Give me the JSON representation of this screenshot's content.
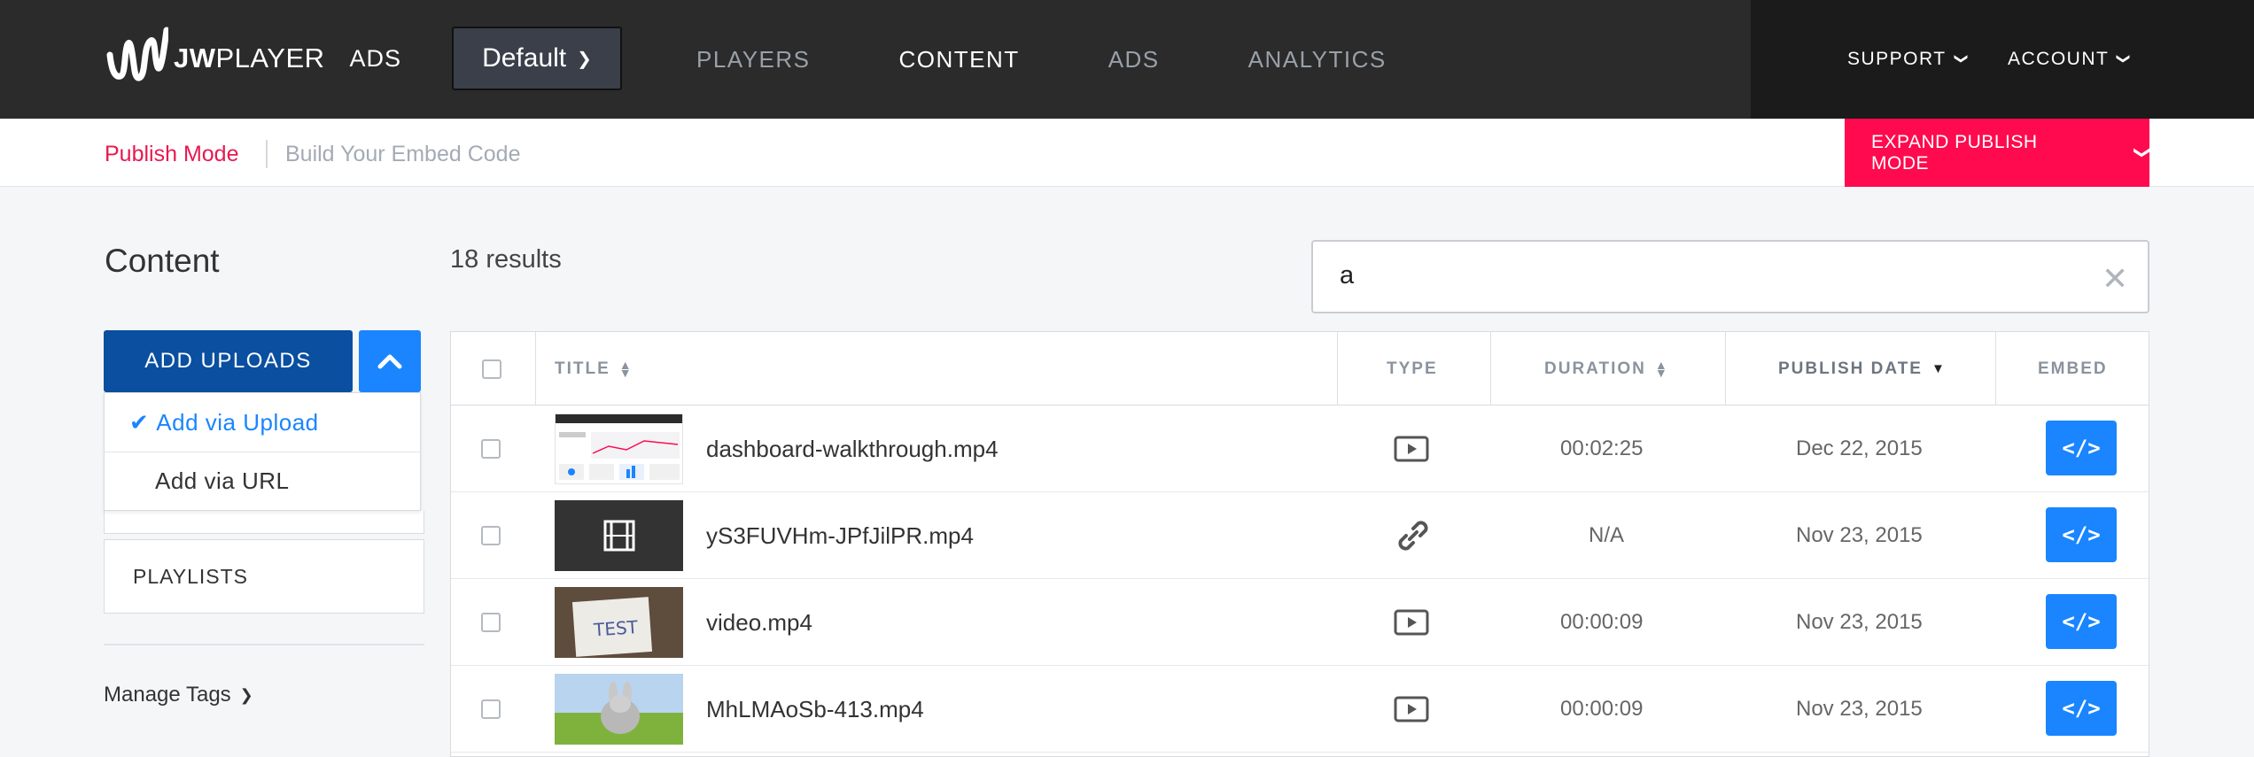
{
  "brand": {
    "logo_text_bold": "JW",
    "logo_text": "PLAYER",
    "product": "ADS"
  },
  "player_select": {
    "value": "Default"
  },
  "nav": {
    "items": [
      {
        "label": "PLAYERS",
        "active": false
      },
      {
        "label": "CONTENT",
        "active": true
      },
      {
        "label": "ADS",
        "active": false
      },
      {
        "label": "ANALYTICS",
        "active": false
      }
    ],
    "support": "SUPPORT",
    "account": "ACCOUNT"
  },
  "publish_bar": {
    "mode_label": "Publish Mode",
    "build_label": "Build Your Embed Code",
    "expand_label": "EXPAND PUBLISH MODE"
  },
  "sidebar": {
    "heading": "Content",
    "add_uploads": "ADD UPLOADS",
    "dropdown": {
      "options": [
        "Add via Upload",
        "Add via URL"
      ],
      "selected": "Add via Upload"
    },
    "playlists": "PLAYLISTS",
    "manage_tags": "Manage Tags"
  },
  "results": {
    "text": "18 results"
  },
  "search": {
    "value": "a"
  },
  "table": {
    "columns": {
      "title": "TITLE",
      "type": "TYPE",
      "duration": "DURATION",
      "publish_date": "PUBLISH DATE",
      "embed": "EMBED"
    },
    "rows": [
      {
        "title": "dashboard-walkthrough.mp4",
        "type": "video",
        "duration": "00:02:25",
        "date": "Dec 22, 2015",
        "thumb": "dashboard"
      },
      {
        "title": "yS3FUVHm-JPfJilPR.mp4",
        "type": "link",
        "duration": "N/A",
        "date": "Nov 23, 2015",
        "thumb": "film"
      },
      {
        "title": "video.mp4",
        "type": "video",
        "duration": "00:00:09",
        "date": "Nov 23, 2015",
        "thumb": "test-paper"
      },
      {
        "title": "MhLMAoSb-413.mp4",
        "type": "video",
        "duration": "00:00:09",
        "date": "Nov 23, 2015",
        "thumb": "bunny"
      }
    ],
    "embed_symbol": "</>"
  },
  "colors": {
    "topbar": "#2b2b2b",
    "accent_pink": "#ff0a4e",
    "accent_blue": "#1a85ff",
    "dark_blue": "#0a4fa0"
  }
}
